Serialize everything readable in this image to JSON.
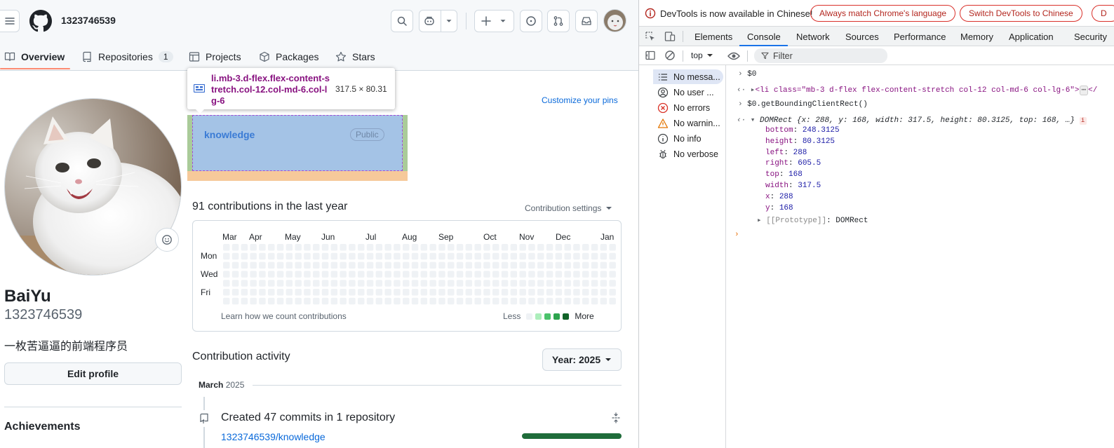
{
  "header": {
    "username": "1323746539"
  },
  "nav": {
    "tabs": [
      {
        "label": "Overview"
      },
      {
        "label": "Repositories",
        "count": "1"
      },
      {
        "label": "Projects"
      },
      {
        "label": "Packages"
      },
      {
        "label": "Stars"
      }
    ]
  },
  "profile": {
    "name": "BaiYu",
    "login": "1323746539",
    "bio": "一枚苦逼逼的前端程序员",
    "edit_label": "Edit profile",
    "achievements_label": "Achievements"
  },
  "pins": {
    "customize_label": "Customize your pins",
    "repo_name": "knowledge",
    "visibility": "Public"
  },
  "inspector_tooltip": {
    "selector": "li.mb-3.d-flex.flex-content-stretch.col-12.col-md-6.col-lg-6",
    "size": "317.5 × 80.31"
  },
  "contributions": {
    "title": "91 contributions in the last year",
    "settings_label": "Contribution settings",
    "months": [
      "Mar",
      "Apr",
      "May",
      "Jun",
      "Jul",
      "Aug",
      "Sep",
      "Oct",
      "Nov",
      "Dec",
      "Jan"
    ],
    "day_labels": [
      "Mon",
      "Wed",
      "Fri"
    ],
    "learn_label": "Learn how we count contributions",
    "legend_less": "Less",
    "legend_more": "More",
    "legend_colors": [
      "#eff2f5",
      "#aceebb",
      "#4ac26b",
      "#2da44e",
      "#116329"
    ]
  },
  "activity": {
    "title": "Contribution activity",
    "year_button": "Year: 2025",
    "month_label": "March",
    "month_year": "2025",
    "commit_title": "Created 47 commits in 1 repository",
    "repo_link": "1323746539/knowledge"
  },
  "devtools": {
    "banner_text": "DevTools is now available in Chinese!",
    "banner_btn_match": "Always match Chrome's language",
    "banner_btn_switch": "Switch DevTools to Chinese",
    "banner_btn_dont": "D",
    "tabs": [
      "Elements",
      "Console",
      "Network",
      "Sources",
      "Performance",
      "Memory",
      "Application",
      "Security"
    ],
    "context": "top",
    "filter_placeholder": "Filter",
    "sidebar": [
      {
        "label": "No messa..."
      },
      {
        "label": "No user ..."
      },
      {
        "label": "No errors"
      },
      {
        "label": "No warnin..."
      },
      {
        "label": "No info"
      },
      {
        "label": "No verbose"
      }
    ],
    "console": {
      "line1": "$0",
      "line2_html": "<li class=\"mb-3 d-flex flex-content-stretch col-12 col-md-6 col-lg-6\">",
      "line2_end": "</",
      "line3": "$0.getBoundingClientRect()",
      "rect_summary_prefix": "DOMRect {",
      "rect_summary_body": "x: 288, y: 168, width: 317.5, height: 80.3125, top: 168, …}",
      "props": [
        {
          "k": "bottom",
          "v": "248.3125"
        },
        {
          "k": "height",
          "v": "80.3125"
        },
        {
          "k": "left",
          "v": "288"
        },
        {
          "k": "right",
          "v": "605.5"
        },
        {
          "k": "top",
          "v": "168"
        },
        {
          "k": "width",
          "v": "317.5"
        },
        {
          "k": "x",
          "v": "288"
        },
        {
          "k": "y",
          "v": "168"
        }
      ],
      "prototype_key": "[[Prototype]]",
      "prototype_val": "DOMRect"
    }
  }
}
